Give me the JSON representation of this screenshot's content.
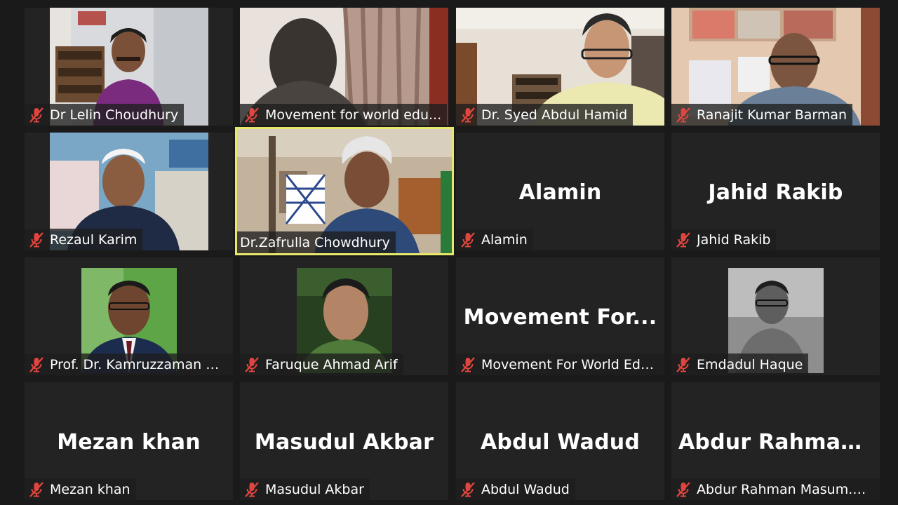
{
  "participants": [
    {
      "display_name": "Dr Lelin Choudhury",
      "video": true,
      "muted": true
    },
    {
      "display_name": "Movement for world edu...",
      "video": true,
      "muted": true
    },
    {
      "display_name": "Dr. Syed Abdul Hamid",
      "video": true,
      "muted": true
    },
    {
      "display_name": "Ranajit Kumar Barman",
      "video": true,
      "muted": true
    },
    {
      "display_name": "Rezaul Karim",
      "video": true,
      "muted": true
    },
    {
      "display_name": "Dr.Zafrulla Chowdhury",
      "video": true,
      "muted": false,
      "active_speaker": true
    },
    {
      "display_name": "Alamin",
      "big_name": "Alamin",
      "video": false,
      "muted": true
    },
    {
      "display_name": "Jahid Rakib",
      "big_name": "Jahid Rakib",
      "video": false,
      "muted": true
    },
    {
      "display_name": "Prof. Dr. Kamruzzaman M...",
      "video": true,
      "muted": true
    },
    {
      "display_name": "Faruque Ahmad Arif",
      "video": true,
      "muted": true
    },
    {
      "display_name": "Movement For World Edu...",
      "big_name": "Movement  For...",
      "video": false,
      "muted": true
    },
    {
      "display_name": "Emdadul Haque",
      "video": true,
      "muted": true
    },
    {
      "display_name": "Mezan khan",
      "big_name": "Mezan khan",
      "video": false,
      "muted": true
    },
    {
      "display_name": "Masudul Akbar",
      "big_name": "Masudul Akbar",
      "video": false,
      "muted": true
    },
    {
      "display_name": "Abdul Wadud",
      "big_name": "Abdul Wadud",
      "video": false,
      "muted": true
    },
    {
      "display_name": "Abdur Rahman Masum.D...",
      "big_name": "Abdur  Rahman...",
      "video": false,
      "muted": true
    }
  ],
  "colors": {
    "background": "#1a1a1a",
    "tile": "#232323",
    "active_speaker_border": "#e8e86a",
    "muted_icon": "#e0453f"
  },
  "icons": {
    "muted": "microphone-muted-icon"
  }
}
